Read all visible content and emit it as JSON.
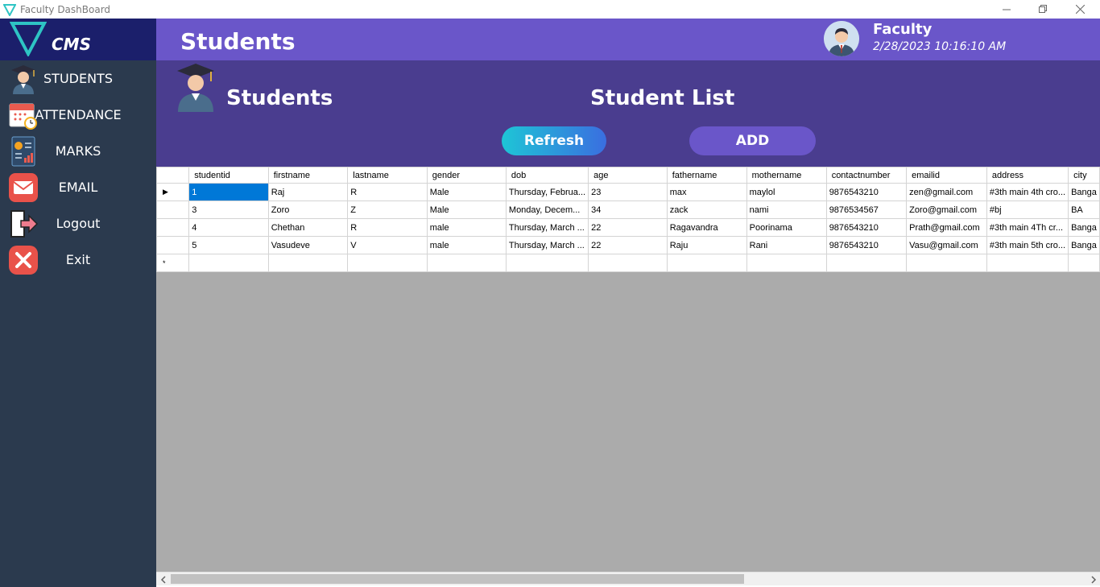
{
  "window": {
    "title": "Faculty DashBoard",
    "minimize": "—",
    "restore": "❐",
    "close": "✕"
  },
  "sidebar": {
    "brand": "CMS",
    "items": [
      {
        "label": "STUDENTS",
        "icon": "student-icon"
      },
      {
        "label": "ATTENDANCE",
        "icon": "calendar-icon"
      },
      {
        "label": "MARKS",
        "icon": "report-icon"
      },
      {
        "label": "EMAIL",
        "icon": "mail-icon"
      },
      {
        "label": "Logout",
        "icon": "logout-icon"
      },
      {
        "label": "Exit",
        "icon": "exit-icon"
      }
    ]
  },
  "header": {
    "title": "Students",
    "user_name": "Faculty",
    "datetime": "2/28/2023 10:16:10 AM"
  },
  "subheader": {
    "title": "Students",
    "list_title": "Student List",
    "refresh_label": "Refresh",
    "add_label": "ADD"
  },
  "grid": {
    "columns": [
      "studentid",
      "firstname",
      "lastname",
      "gender",
      "dob",
      "age",
      "fathername",
      "mothername",
      "contactnumber",
      "emailid",
      "address",
      "city"
    ],
    "rows": [
      [
        "1",
        "Raj",
        "R",
        "Male",
        "Thursday, Februa...",
        "23",
        "max",
        "maylol",
        "9876543210",
        "zen@gmail.com",
        "#3th main 4th cro...",
        "Banga"
      ],
      [
        "3",
        "Zoro",
        "Z",
        "Male",
        "Monday, Decem...",
        "34",
        "zack",
        "nami",
        "9876534567",
        "Zoro@gmail.com",
        "#bj",
        "BA"
      ],
      [
        "4",
        "Chethan",
        "R",
        "male",
        "Thursday, March ...",
        "22",
        "Ragavandra",
        "Poorinama",
        "9876543210",
        "Prath@gmail.com",
        "#3th main 4Th cr...",
        "Banga"
      ],
      [
        "5",
        "Vasudeve",
        "V",
        "male",
        "Thursday, March ...",
        "22",
        "Raju",
        "Rani",
        "9876543210",
        "Vasu@gmail.com",
        "#3th main 5th cro...",
        "Banga"
      ]
    ],
    "current_row_marker": "▶",
    "new_row_marker": "*"
  },
  "colors": {
    "sidebar": "#2b3a4e",
    "brand": "#1b1f6b",
    "header": "#6a56c9",
    "subheader": "#4a3d8f",
    "selection": "#0078d7"
  }
}
